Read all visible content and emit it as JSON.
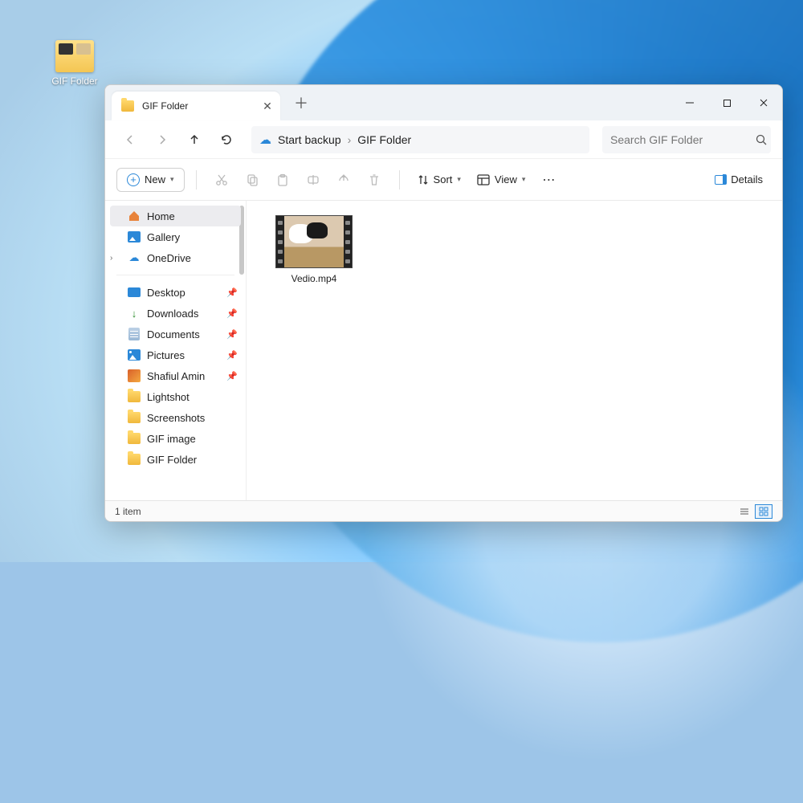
{
  "desktop": {
    "shortcut_label": "GIF Folder"
  },
  "window": {
    "tab_title": "GIF Folder",
    "breadcrumb": {
      "root": "Start backup",
      "current": "GIF Folder"
    },
    "search_placeholder": "Search GIF Folder",
    "commands": {
      "new_label": "New",
      "sort_label": "Sort",
      "view_label": "View",
      "details_label": "Details"
    },
    "sidebar": {
      "primary": [
        {
          "label": "Home"
        },
        {
          "label": "Gallery"
        },
        {
          "label": "OneDrive"
        }
      ],
      "pinned": [
        {
          "label": "Desktop"
        },
        {
          "label": "Downloads"
        },
        {
          "label": "Documents"
        },
        {
          "label": "Pictures"
        },
        {
          "label": "Shafiul Amin"
        },
        {
          "label": "Lightshot"
        },
        {
          "label": "Screenshots"
        },
        {
          "label": "GIF image"
        },
        {
          "label": "GIF Folder"
        }
      ]
    },
    "files": [
      {
        "name": "Vedio.mp4"
      }
    ],
    "status": {
      "count_text": "1 item"
    }
  }
}
